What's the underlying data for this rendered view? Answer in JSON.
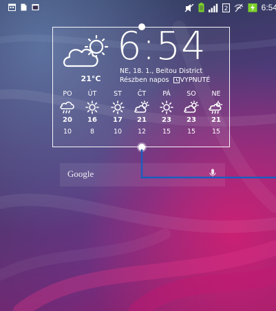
{
  "status_bar": {
    "time": "6:54",
    "left_icons": [
      "calendar-icon",
      "file-icon",
      "window-icon"
    ],
    "right_icons": [
      "mute-icon",
      "battery-saver-icon",
      "signal-icon",
      "data-icon",
      "wifi-icon",
      "battery-charging-icon"
    ],
    "colors": {
      "green": "#7bd12a"
    }
  },
  "widget": {
    "clock": "6:54",
    "current_temp": "21°C",
    "date_location": "NE, 18. 1., Beitou District",
    "alarm_label": "Részben napos",
    "alarm_state": "VYPNUTÉ",
    "current_icon": "partly-sunny-icon",
    "forecast": [
      {
        "day": "PO",
        "icon": "rain-cloud-icon",
        "high": "20",
        "low": "10"
      },
      {
        "day": "ÚT",
        "icon": "sun-icon",
        "high": "16",
        "low": "8"
      },
      {
        "day": "ST",
        "icon": "sun-icon",
        "high": "17",
        "low": "10"
      },
      {
        "day": "ČT",
        "icon": "partly-sunny-icon",
        "high": "21",
        "low": "12"
      },
      {
        "day": "PÁ",
        "icon": "sun-icon",
        "high": "23",
        "low": "15"
      },
      {
        "day": "SO",
        "icon": "partly-sunny-icon",
        "high": "23",
        "low": "15"
      },
      {
        "day": "NE",
        "icon": "partly-cloudy-rain-icon",
        "high": "21",
        "low": "15"
      }
    ]
  },
  "search": {
    "label": "Google",
    "icon": "mic-icon"
  },
  "accent_color": "#1a5dbf"
}
